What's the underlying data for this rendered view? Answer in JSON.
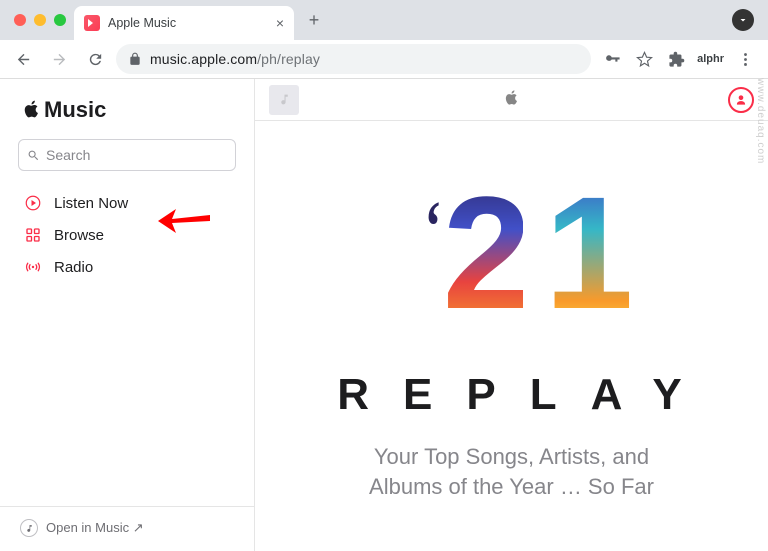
{
  "browser": {
    "tab_title": "Apple Music",
    "url_host": "music.apple.com",
    "url_path": "/ph/replay",
    "ext_label": "alphr"
  },
  "sidebar": {
    "brand": "Music",
    "search_placeholder": "Search",
    "items": [
      {
        "id": "listen-now",
        "label": "Listen Now"
      },
      {
        "id": "browse",
        "label": "Browse"
      },
      {
        "id": "radio",
        "label": "Radio"
      }
    ],
    "footer_label": "Open in Music ↗"
  },
  "hero": {
    "year_tick": "‘",
    "year_a": "2",
    "year_b": "1",
    "title": "REPLAY",
    "subtitle_line1": "Your Top Songs, Artists, and",
    "subtitle_line2": "Albums of the Year … So Far"
  },
  "watermark": "www.deuaq.com"
}
